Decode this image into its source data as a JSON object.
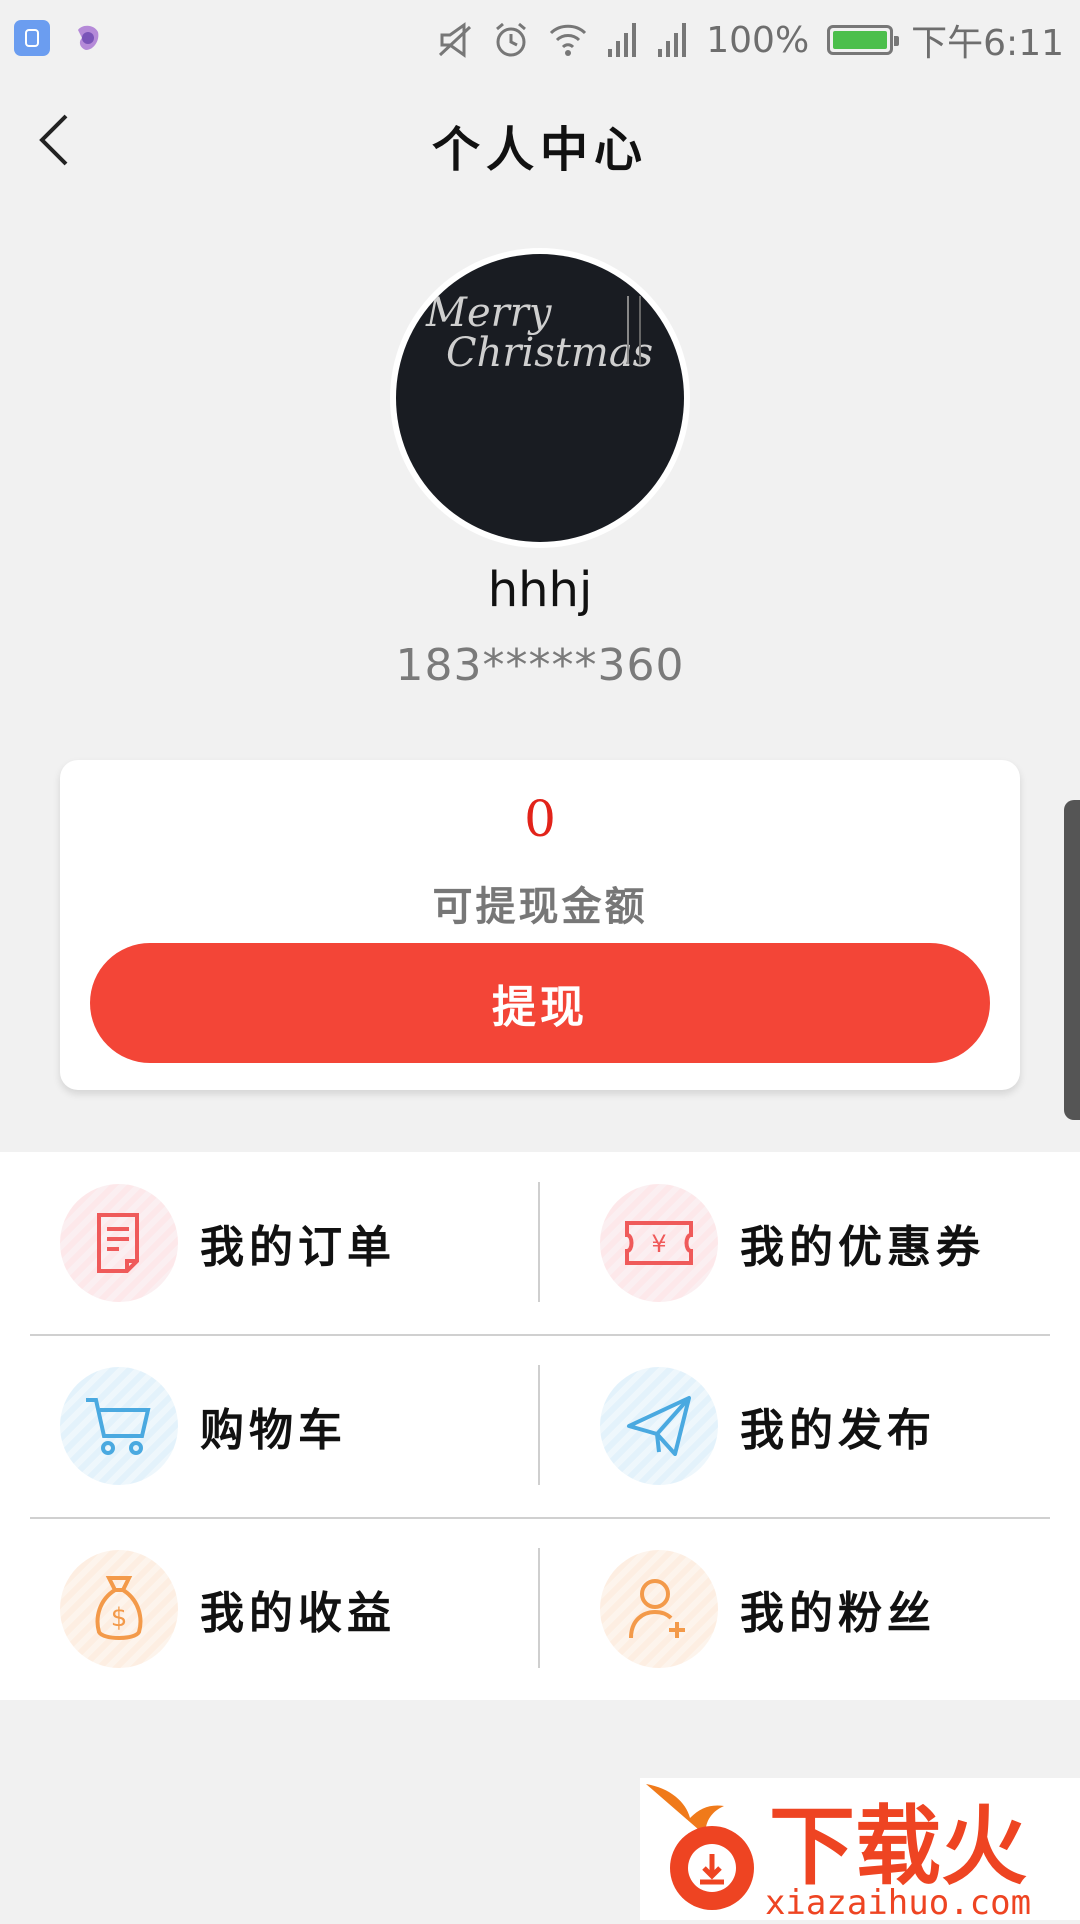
{
  "status_bar": {
    "battery": "100%",
    "time": "下午6:11",
    "icons": [
      "app-icon",
      "fairy-app-icon",
      "mute-icon",
      "alarm-icon",
      "wifi-icon",
      "signal-icon",
      "signal-icon",
      "battery-icon"
    ]
  },
  "header": {
    "title": "个人中心",
    "back_icon": "chevron-left-icon"
  },
  "profile": {
    "avatar_text": "Merry Christmas",
    "username": "hhhj",
    "phone": "183*****360"
  },
  "balance": {
    "amount": "0",
    "label": "可提现金额",
    "button_label": "提现",
    "amount_color": "#e2231a",
    "button_color": "#f34537"
  },
  "menu": {
    "items": [
      {
        "label": "我的订单",
        "icon": "order-document-icon"
      },
      {
        "label": "我的优惠券",
        "icon": "coupon-ticket-icon"
      },
      {
        "label": "购物车",
        "icon": "shopping-cart-icon"
      },
      {
        "label": "我的发布",
        "icon": "paper-plane-icon"
      },
      {
        "label": "我的收益",
        "icon": "money-bag-icon"
      },
      {
        "label": "我的粉丝",
        "icon": "add-follower-icon"
      }
    ]
  },
  "watermark": {
    "text": "下载火",
    "url": "xiazaihuo.com"
  }
}
